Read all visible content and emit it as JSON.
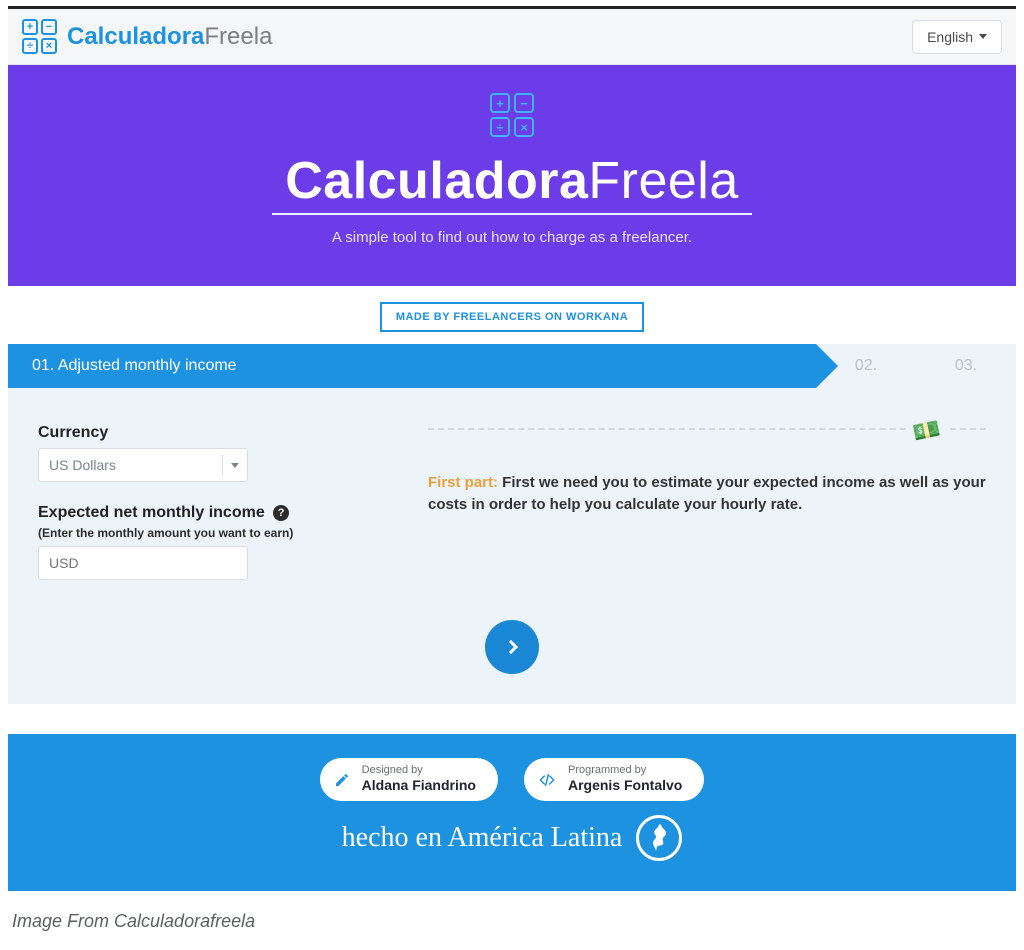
{
  "navbar": {
    "brand_bold": "Calculadora",
    "brand_light": "Freela",
    "language": "English"
  },
  "hero": {
    "title_bold": "Calculadora",
    "title_light": "Freela",
    "subtitle": "A simple tool to find out how to charge as a freelancer."
  },
  "made_by": "MADE BY FREELANCERS ON WORKANA",
  "steps": {
    "active": "01. Adjusted monthly income",
    "two": "02.",
    "three": "03."
  },
  "form": {
    "currency_label": "Currency",
    "currency_value": "US Dollars",
    "income_label": "Expected net monthly income",
    "income_hint": "(Enter the monthly amount you want to earn)",
    "income_placeholder": "USD"
  },
  "info": {
    "highlight": "First part:",
    "text": " First we need you to estimate your expected income as well as your costs in order to help you calculate your hourly rate."
  },
  "footer": {
    "designed_label": "Designed by",
    "designed_name": "Aldana Fiandrino",
    "programmed_label": "Programmed by",
    "programmed_name": "Argenis Fontalvo",
    "tagline": "hecho en América Latina"
  },
  "caption": "Image From Calculadorafreela"
}
